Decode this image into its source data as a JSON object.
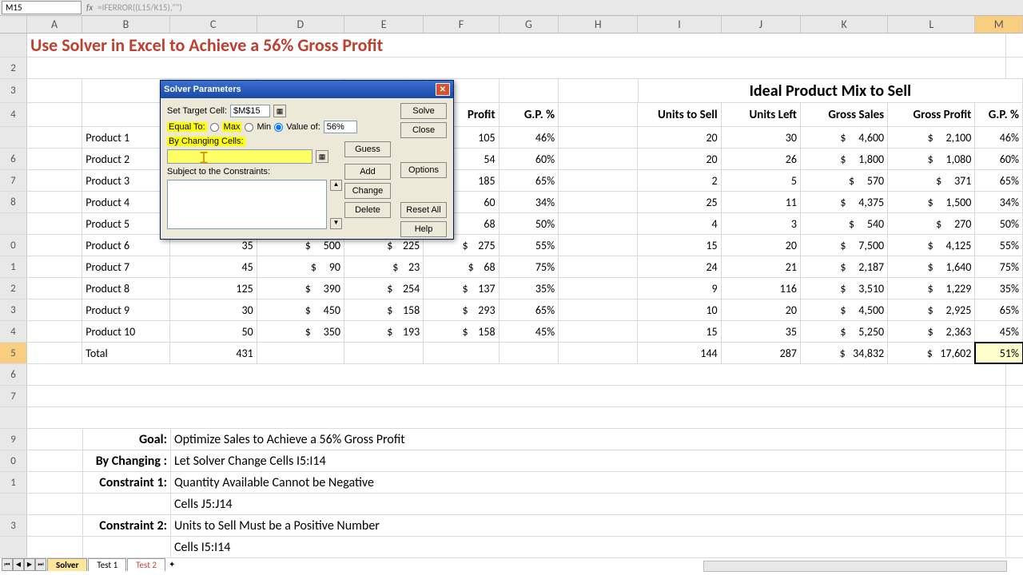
{
  "formula_bar": {
    "name_box": "M15",
    "formula": "=IFERROR((L15/K15),\"\")"
  },
  "columns": [
    "A",
    "B",
    "C",
    "D",
    "E",
    "F",
    "G",
    "H",
    "I",
    "J",
    "K",
    "L",
    "M"
  ],
  "selected_col": "M",
  "title": "Use Solver in Excel to Achieve a 56% Gross Profit",
  "ideal_header": "Ideal Product Mix to Sell",
  "col_headers_left": {
    "F": "Profit",
    "G": "G.P. %"
  },
  "col_headers_right": {
    "I": "Units to Sell",
    "J": "Units Left",
    "K": "Gross Sales",
    "L": "Gross Profit",
    "M": "G.P. %"
  },
  "row_nums": [
    "",
    "2",
    "3",
    "4",
    "",
    "6",
    "7",
    "8",
    "",
    "0",
    "1",
    "2",
    "3",
    "4",
    "5",
    "6",
    "7",
    "",
    "9",
    "0",
    "1",
    "",
    "3",
    ""
  ],
  "selected_row_idx": 14,
  "products": [
    {
      "name": "Product 1",
      "C": "",
      "D": "",
      "E": "",
      "F": "105",
      "G": "46%",
      "I": "20",
      "J": "30",
      "K": "4,600",
      "L": "2,100",
      "M": "46%"
    },
    {
      "name": "Product 2",
      "C": "",
      "D": "",
      "E": "",
      "F": "54",
      "G": "60%",
      "I": "20",
      "J": "26",
      "K": "1,800",
      "L": "1,080",
      "M": "60%"
    },
    {
      "name": "Product 3",
      "C": "",
      "D": "",
      "E": "",
      "F": "185",
      "G": "65%",
      "I": "2",
      "J": "5",
      "K": "570",
      "L": "371",
      "M": "65%"
    },
    {
      "name": "Product 4",
      "C": "",
      "D": "",
      "E": "",
      "F": "60",
      "G": "34%",
      "I": "25",
      "J": "11",
      "K": "4,375",
      "L": "1,500",
      "M": "34%"
    },
    {
      "name": "Product 5",
      "C": "",
      "D": "",
      "E": "",
      "F": "68",
      "G": "50%",
      "I": "4",
      "J": "3",
      "K": "540",
      "L": "270",
      "M": "50%"
    },
    {
      "name": "Product 6",
      "C": "35",
      "D": "500",
      "E": "225",
      "F": "275",
      "G": "55%",
      "I": "15",
      "J": "20",
      "K": "7,500",
      "L": "4,125",
      "M": "55%"
    },
    {
      "name": "Product 7",
      "C": "45",
      "D": "90",
      "E": "23",
      "F": "68",
      "G": "75%",
      "I": "24",
      "J": "21",
      "K": "2,187",
      "L": "1,640",
      "M": "75%"
    },
    {
      "name": "Product 8",
      "C": "125",
      "D": "390",
      "E": "254",
      "F": "137",
      "G": "35%",
      "I": "9",
      "J": "116",
      "K": "3,510",
      "L": "1,229",
      "M": "35%"
    },
    {
      "name": "Product 9",
      "C": "30",
      "D": "450",
      "E": "158",
      "F": "293",
      "G": "65%",
      "I": "10",
      "J": "20",
      "K": "4,500",
      "L": "2,925",
      "M": "65%"
    },
    {
      "name": "Product 10",
      "C": "50",
      "D": "350",
      "E": "193",
      "F": "158",
      "G": "45%",
      "I": "15",
      "J": "35",
      "K": "5,250",
      "L": "2,363",
      "M": "45%"
    }
  ],
  "total": {
    "label": "Total",
    "C": "431",
    "I": "144",
    "J": "287",
    "K": "34,832",
    "L": "17,602",
    "M": "51%"
  },
  "notes": {
    "goal_lbl": "Goal:",
    "goal": "Optimize Sales to Achieve a 56% Gross Profit",
    "chg_lbl": "By Changing :",
    "chg": "Let Solver Change Cells I5:I14",
    "c1_lbl": "Constraint 1:",
    "c1": "Quantity Available Cannot be Negative",
    "c1b": "Cells J5:J14",
    "c2_lbl": "Constraint 2:",
    "c2": "Units to Sell Must be a Positive Number",
    "c2b": "Cells I5:I14"
  },
  "dialog": {
    "title": "Solver Parameters",
    "set_target": "Set Target Cell:",
    "target_val": "$M$15",
    "equal_to": "Equal To:",
    "max": "Max",
    "min": "Min",
    "value_of": "Value of:",
    "value_input": "56%",
    "by_changing": "By Changing Cells:",
    "changing_val": "",
    "subject": "Subject to the Constraints:",
    "solve": "Solve",
    "close": "Close",
    "options": "Options",
    "reset": "Reset All",
    "help": "Help",
    "guess": "Guess",
    "add": "Add",
    "change": "Change",
    "delete": "Delete"
  },
  "tabs": {
    "solver": "Solver",
    "test1": "Test 1",
    "test2": "Test 2"
  },
  "dollar": "$"
}
